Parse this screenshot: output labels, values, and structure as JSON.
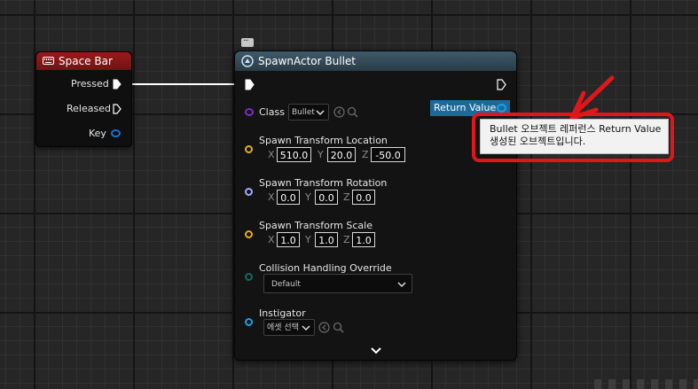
{
  "event_node": {
    "title": "Space Bar",
    "pins": [
      {
        "label": "Pressed"
      },
      {
        "label": "Released"
      },
      {
        "label": "Key"
      }
    ]
  },
  "spawn_node": {
    "title": "SpawnActor Bullet",
    "class_label": "Class",
    "class_value": "Bullet",
    "return_value_label": "Return Value",
    "location": {
      "label": "Spawn Transform Location",
      "x": "510.0",
      "y": "20.0",
      "z": "-50.0"
    },
    "rotation": {
      "label": "Spawn Transform Rotation",
      "x": "0.0",
      "y": "0.0",
      "z": "0.0"
    },
    "scale": {
      "label": "Spawn Transform Scale",
      "x": "1.0",
      "y": "1.0",
      "z": "1.0"
    },
    "axes": {
      "x": "X",
      "y": "Y",
      "z": "Z"
    },
    "collision": {
      "label": "Collision Handling Override",
      "value": "Default"
    },
    "instigator": {
      "label": "Instigator",
      "value": "에셋 선택"
    }
  },
  "annotation": {
    "line1": "Bullet 오브젝트 레퍼런스 Return Value",
    "line2": "생성된 오브젝트입니다."
  },
  "colors": {
    "event_header": "#9a1a1a",
    "spawn_header": "#3f5a6a",
    "class_pin": "#7b2fbf",
    "vector_pin": "#e0b020",
    "rotator_pin": "#9fb0ff",
    "enum_pin": "#0a6f62",
    "object_pin": "#1aa0e6",
    "annotation": "#e0161b"
  },
  "icons": [
    "keyboard-icon",
    "spawn-function-icon",
    "exec-pin-icon",
    "chevron-down-icon",
    "browse-arrow-icon",
    "search-icon",
    "comment-bubble-icon"
  ]
}
